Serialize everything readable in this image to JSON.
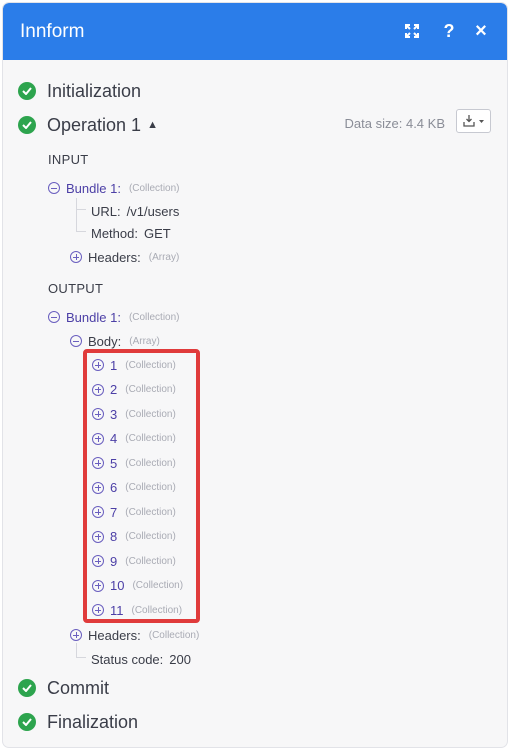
{
  "header": {
    "title": "Innform",
    "color": "#2b7de9",
    "buttons": [
      "expand-icon",
      "help-icon",
      "close-icon"
    ],
    "help_label": "?",
    "close_label": "×"
  },
  "steps": {
    "initialization": "Initialization",
    "operation": "Operation 1",
    "commit": "Commit",
    "finalization": "Finalization"
  },
  "operation": {
    "data_size": "Data size: 4.4 KB",
    "input_heading": "INPUT",
    "output_heading": "OUTPUT",
    "input": {
      "bundle_label": "Bundle 1:",
      "bundle_type": "(Collection)",
      "url_key": "URL:",
      "url_value": "/v1/users",
      "method_key": "Method:",
      "method_value": "GET",
      "headers_key": "Headers:",
      "headers_type": "(Array)"
    },
    "output": {
      "bundle_label": "Bundle 1:",
      "bundle_type": "(Collection)",
      "body_key": "Body:",
      "body_type": "(Array)",
      "items": [
        {
          "index": "1",
          "type": "(Collection)"
        },
        {
          "index": "2",
          "type": "(Collection)"
        },
        {
          "index": "3",
          "type": "(Collection)"
        },
        {
          "index": "4",
          "type": "(Collection)"
        },
        {
          "index": "5",
          "type": "(Collection)"
        },
        {
          "index": "6",
          "type": "(Collection)"
        },
        {
          "index": "7",
          "type": "(Collection)"
        },
        {
          "index": "8",
          "type": "(Collection)"
        },
        {
          "index": "9",
          "type": "(Collection)"
        },
        {
          "index": "10",
          "type": "(Collection)"
        },
        {
          "index": "11",
          "type": "(Collection)"
        }
      ],
      "headers_key": "Headers:",
      "headers_type": "(Collection)",
      "status_key": "Status code:",
      "status_value": "200"
    }
  },
  "colors": {
    "success": "#2da44e",
    "highlight": "#e03b3b"
  }
}
